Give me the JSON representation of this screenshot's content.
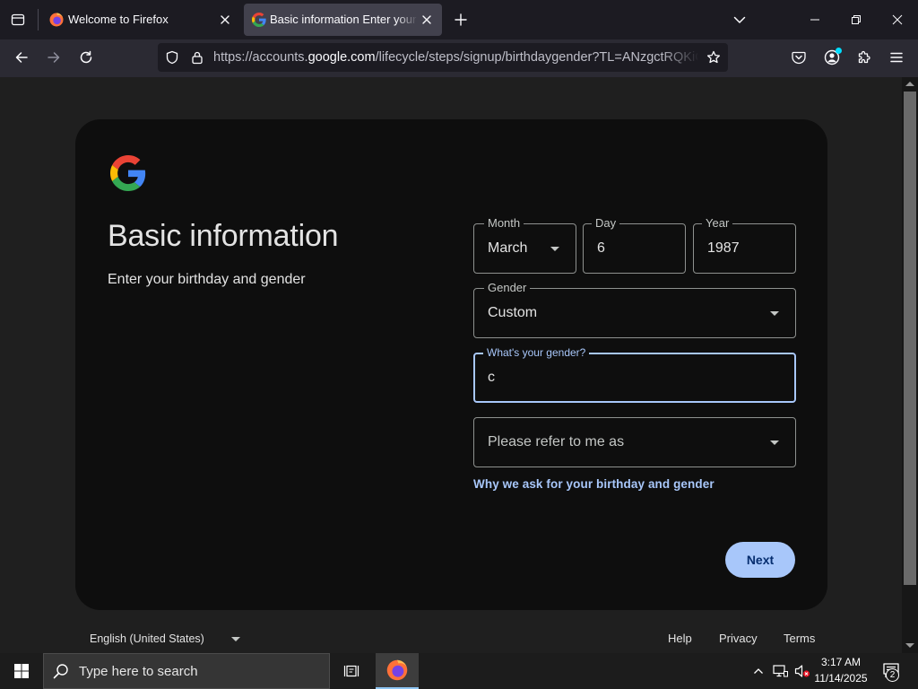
{
  "browser": {
    "tabs": [
      {
        "label": "Welcome to Firefox",
        "icon": "firefox-icon",
        "active": false
      },
      {
        "label": "Basic information Enter your bir",
        "icon": "google-g-icon",
        "active": true
      }
    ],
    "url": {
      "prefix": "https://accounts.",
      "domain": "google.com",
      "path": "/lifecycle/steps/signup/birthdaygender?TL=ANzgctRQKiOM"
    },
    "toolbar_icons": [
      "back-arrow-icon",
      "forward-arrow-icon",
      "reload-icon",
      "shield-icon",
      "lock-icon",
      "star-icon",
      "pocket-icon",
      "account-icon",
      "extensions-icon",
      "menu-icon"
    ]
  },
  "page": {
    "title": "Basic information",
    "subtitle": "Enter your birthday and gender",
    "birthday": {
      "month": {
        "label": "Month",
        "value": "March"
      },
      "day": {
        "label": "Day",
        "value": "6"
      },
      "year": {
        "label": "Year",
        "value": "1987"
      }
    },
    "gender": {
      "label": "Gender",
      "value": "Custom"
    },
    "custom_gender": {
      "label": "What's your gender?",
      "value": "c"
    },
    "pronouns": {
      "placeholder": "Please refer to me as"
    },
    "why_link": "Why we ask for your birthday and gender",
    "next_button": "Next"
  },
  "footer": {
    "language": "English (United States)",
    "links": [
      "Help",
      "Privacy",
      "Terms"
    ]
  },
  "taskbar": {
    "search_placeholder": "Type here to search",
    "time": "3:17 AM",
    "date": "11/14/2025",
    "notification_count": "2"
  },
  "colors": {
    "tabstrip_bg": "#1c1b22",
    "navbar_bg": "#2b2a33",
    "active_tab_bg": "#42414d",
    "page_bg": "#1f1f1f",
    "card_bg": "#0e0e0e",
    "accent": "#a8c7fa",
    "button_text": "#062e6f",
    "muted_red": "#e81123"
  }
}
